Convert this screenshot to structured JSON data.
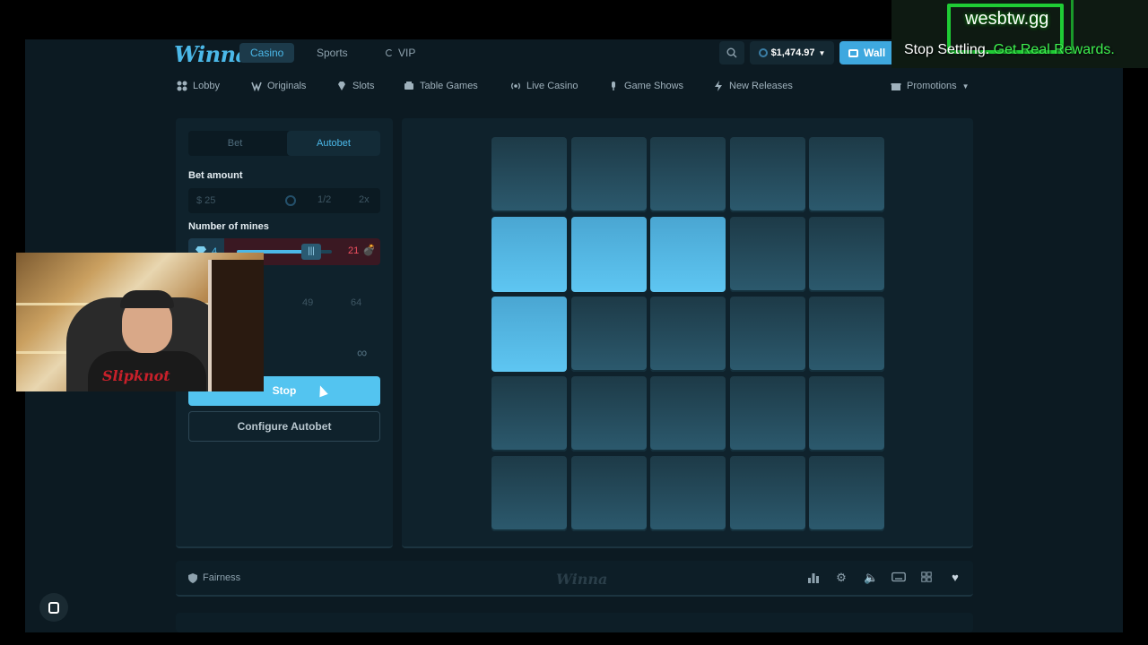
{
  "header": {
    "logo": "Winna",
    "tabs": [
      {
        "label": "Casino",
        "active": true
      },
      {
        "label": "Sports",
        "active": false
      },
      {
        "label": "VIP",
        "active": false
      }
    ],
    "balance": "$1,474.97",
    "wallet_label": "Wall"
  },
  "overlay": {
    "site": "wesbtw.gg",
    "tagline_part1": "Stop Settling.",
    "tagline_part2": "Get Real Rewards."
  },
  "subnav": {
    "items": [
      {
        "label": "Lobby",
        "icon": "grid-icon"
      },
      {
        "label": "Originals",
        "icon": "w-icon"
      },
      {
        "label": "Slots",
        "icon": "diamond-icon"
      },
      {
        "label": "Table Games",
        "icon": "table-icon"
      },
      {
        "label": "Live Casino",
        "icon": "broadcast-icon"
      },
      {
        "label": "Game Shows",
        "icon": "mic-icon"
      },
      {
        "label": "New Releases",
        "icon": "bolt-icon"
      }
    ],
    "promotions": "Promotions"
  },
  "panel": {
    "mode_bet": "Bet",
    "mode_autobet": "Autobet",
    "bet_amount_label": "Bet amount",
    "bet_value": "$ 25",
    "half": "1/2",
    "double": "2x",
    "mines_label": "Number of mines",
    "gems": "4",
    "mines": "21",
    "mines_level": 0.84,
    "presets": [
      "49",
      "64"
    ],
    "infinity": "∞",
    "stop": "Stop",
    "configure": "Configure Autobet"
  },
  "webcam": {
    "shirt_text": "Slipknot"
  },
  "grid": {
    "rows": 5,
    "cols": 5,
    "selected": [
      5,
      6,
      7,
      10
    ]
  },
  "footer": {
    "fairness": "Fairness",
    "logo": "Winna"
  },
  "colors": {
    "accent": "#4bb8e8",
    "tile_selected": "#5ec6f2",
    "tile": "#2c5a6e",
    "mine_red": "#f05060"
  }
}
